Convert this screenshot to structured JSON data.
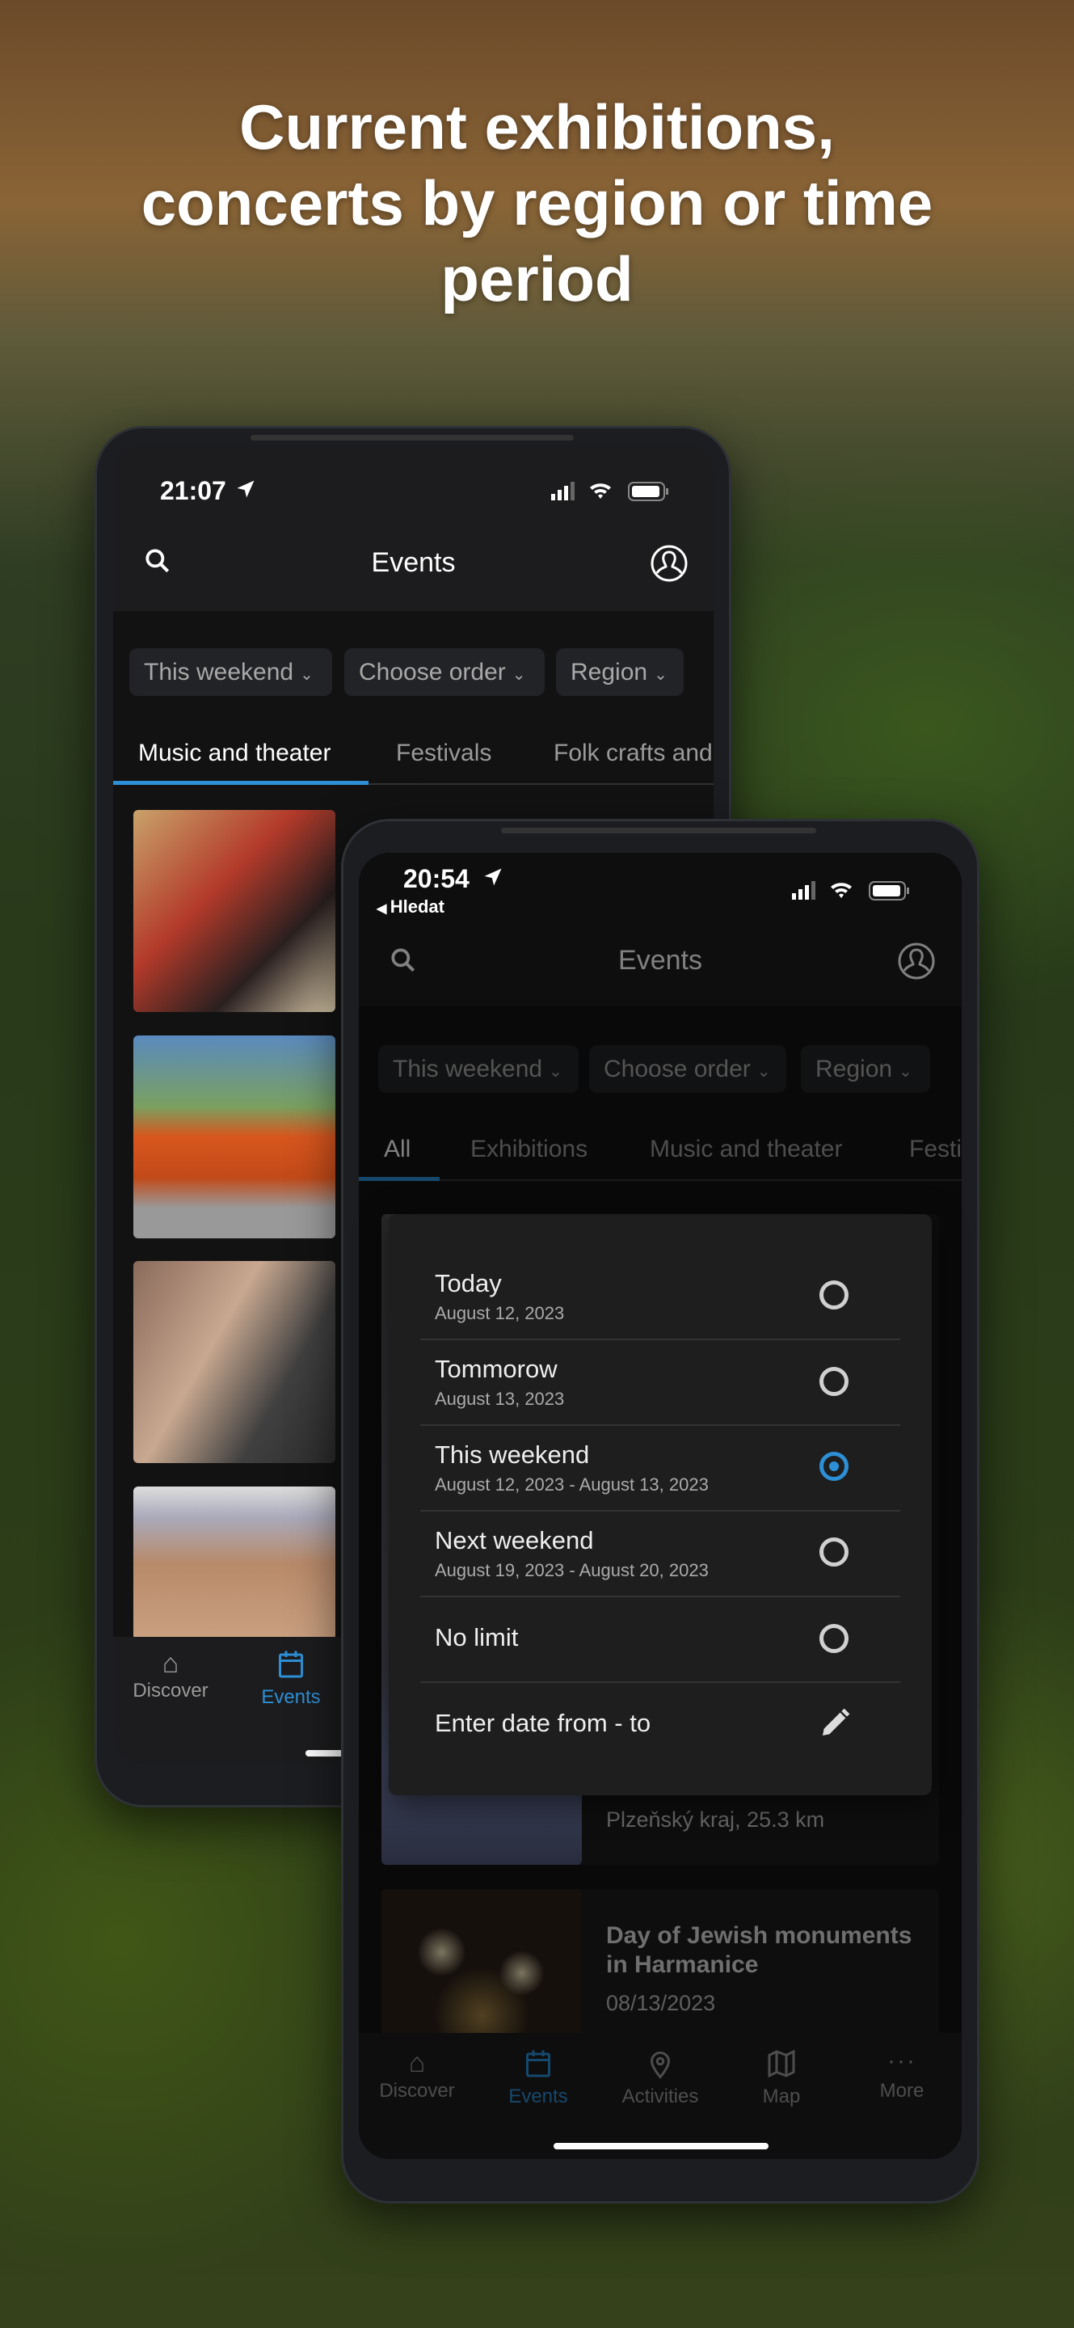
{
  "headline": {
    "line1": "Current exhibitions,",
    "line2": "concerts by region or time",
    "line3": "period"
  },
  "colors": {
    "accent": "#2d8fd5",
    "surface": "#1c1c1e",
    "background": "#121212"
  },
  "back_phone": {
    "status_time": "21:07",
    "header": {
      "title": "Events",
      "search_icon": "search-icon",
      "profile_icon": "user-circle-icon"
    },
    "filters": [
      "This weekend",
      "Choose order",
      "Region"
    ],
    "tabs": [
      "Music and theater",
      "Festivals",
      "Folk crafts and"
    ],
    "active_tab": "Music and theater",
    "nav": [
      {
        "label": "Discover",
        "icon": "home-icon"
      },
      {
        "label": "Events",
        "icon": "calendar-icon",
        "active": true
      }
    ]
  },
  "front_phone": {
    "status_time": "20:54",
    "back_link": "Hledat",
    "header": {
      "title": "Events"
    },
    "filters": [
      "This weekend",
      "Choose order",
      "Region"
    ],
    "tabs": [
      "All",
      "Exhibitions",
      "Music and theater",
      "Festi"
    ],
    "active_tab": "All",
    "events": [
      {
        "location": "Plzeňský kraj, 25.3 km"
      },
      {
        "title_line1": "Day of Jewish monuments",
        "title_line2": "in Harmanice",
        "date": "08/13/2023"
      }
    ],
    "nav": [
      {
        "label": "Discover",
        "icon": "home-icon"
      },
      {
        "label": "Events",
        "icon": "calendar-icon",
        "active": true
      },
      {
        "label": "Activities",
        "icon": "map-pin-icon"
      },
      {
        "label": "Map",
        "icon": "map-icon"
      },
      {
        "label": "More",
        "icon": "more-icon"
      }
    ]
  },
  "date_picker": {
    "options": [
      {
        "title": "Today",
        "subtitle": "August 12, 2023",
        "selected": false
      },
      {
        "title": "Tommorow",
        "subtitle": "August 13, 2023",
        "selected": false
      },
      {
        "title": "This weekend",
        "subtitle": "August 12, 2023 - August 13, 2023",
        "selected": true
      },
      {
        "title": "Next weekend",
        "subtitle": "August 19, 2023 - August 20, 2023",
        "selected": false
      },
      {
        "title": "No limit",
        "selected": false
      }
    ],
    "custom_range": "Enter date from - to"
  }
}
